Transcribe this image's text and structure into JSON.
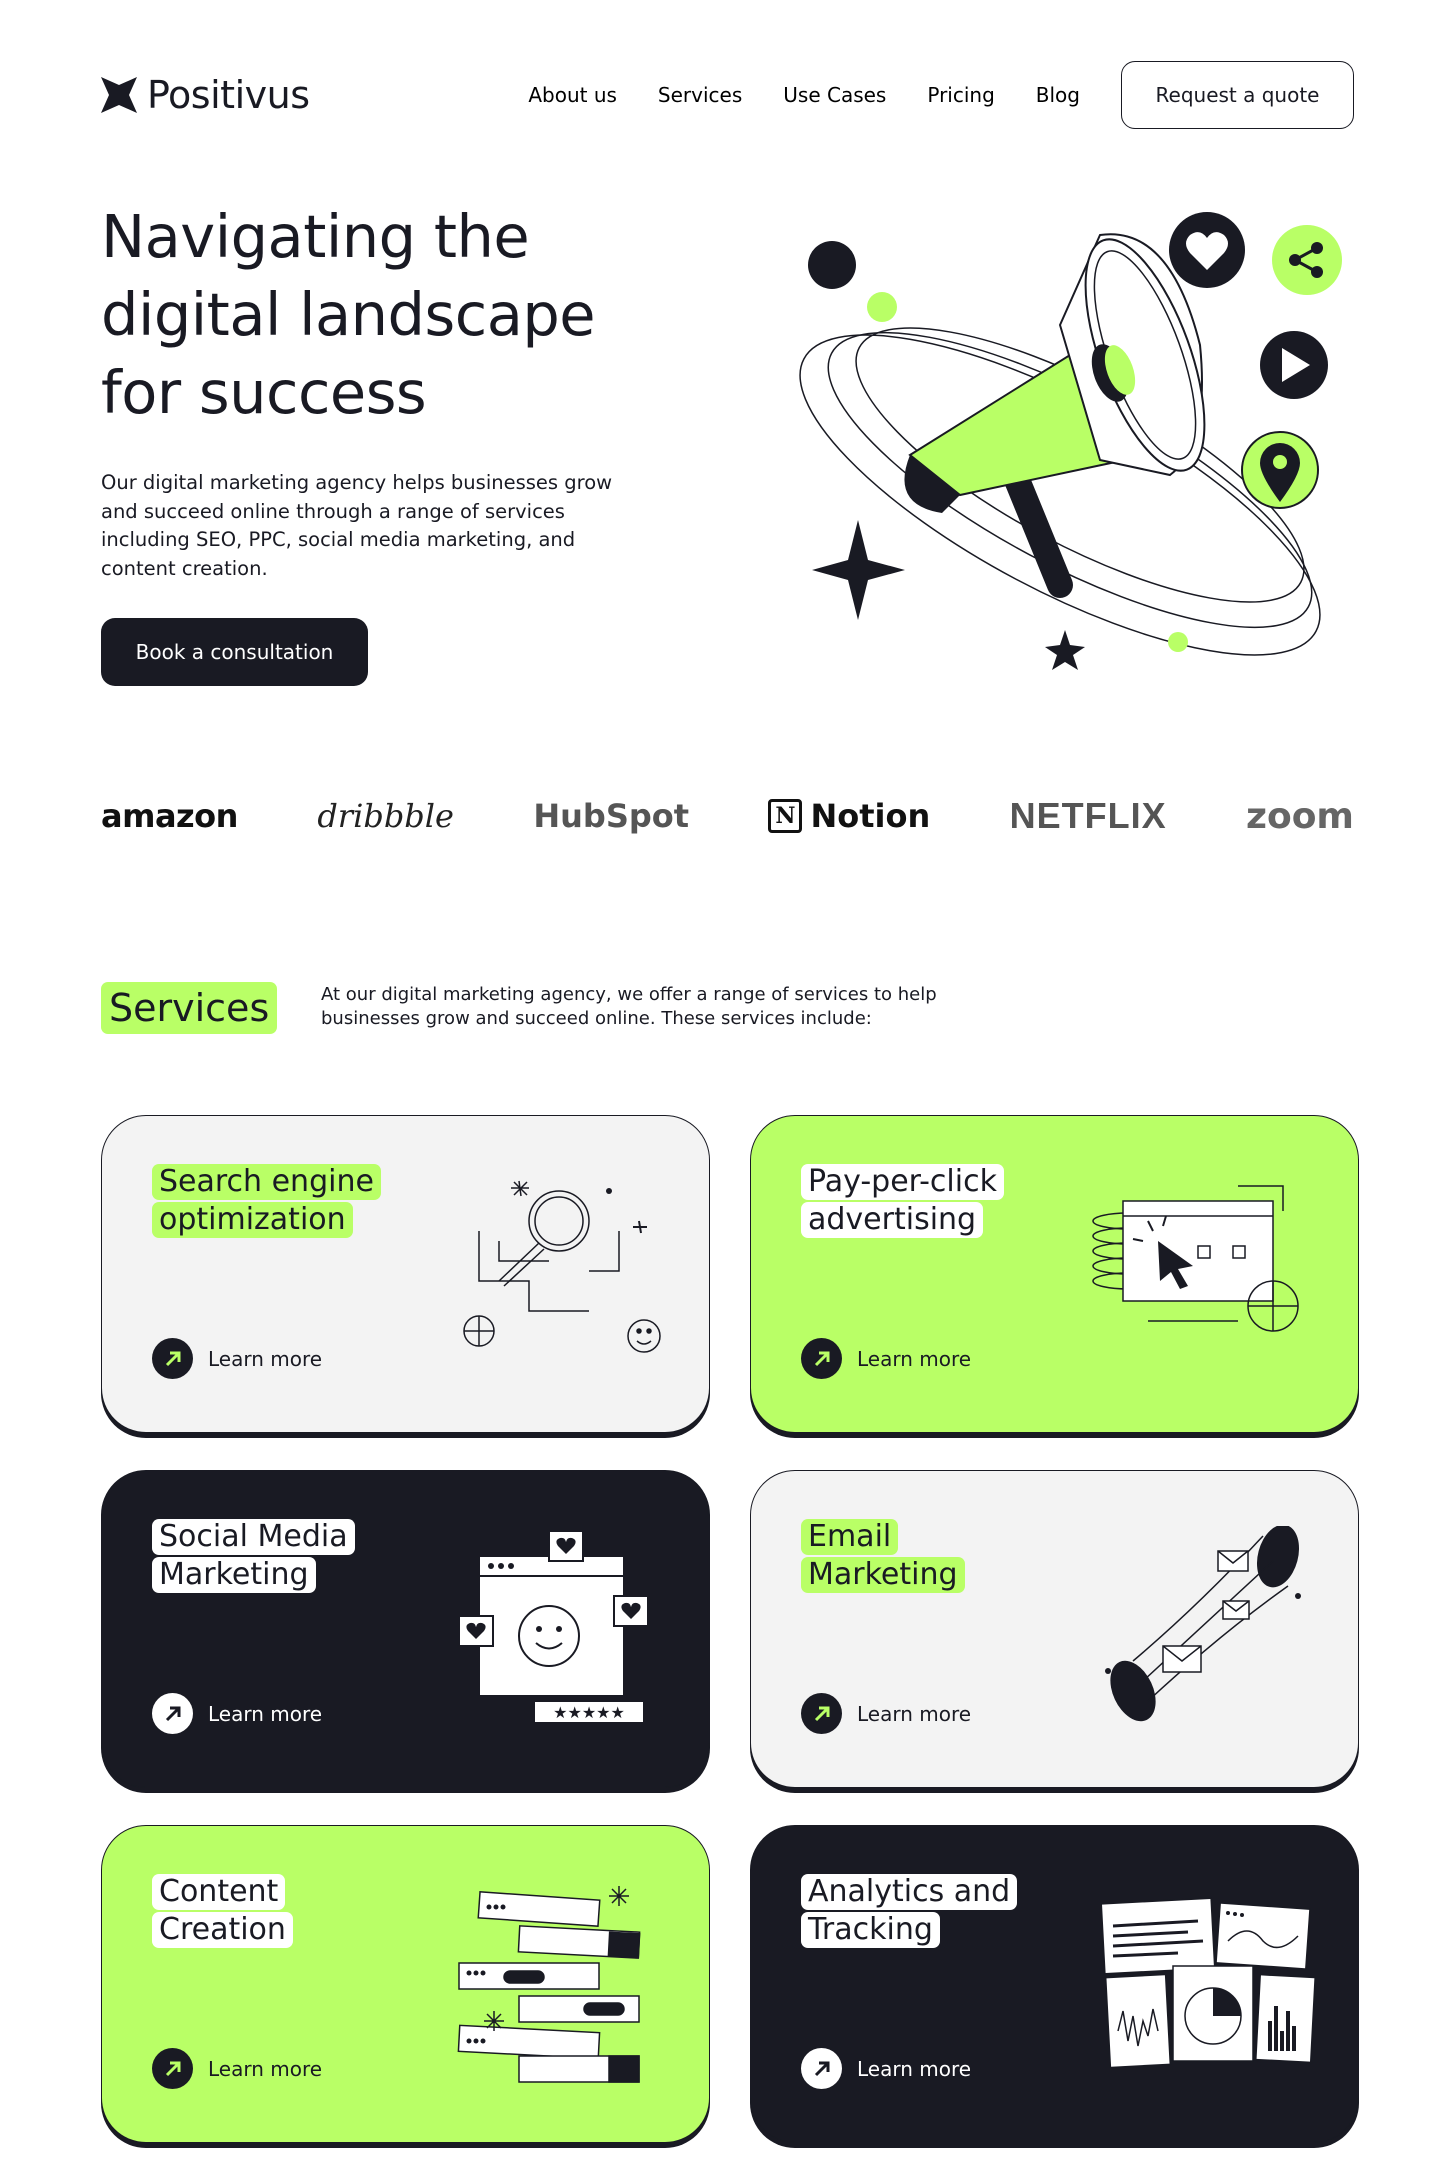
{
  "header": {
    "logo_text": "Positivus",
    "nav": [
      "About us",
      "Services",
      "Use Cases",
      "Pricing",
      "Blog"
    ],
    "cta": "Request a quote"
  },
  "hero": {
    "title": "Navigating the digital landscape for success",
    "description": "Our digital marketing agency helps businesses grow and succeed online through a range of services including SEO, PPC, social media marketing, and content creation.",
    "button": "Book a consultation"
  },
  "logos": {
    "amazon": "amazon",
    "dribbble": "dribbble",
    "hubspot": "HubSpot",
    "notion": "Notion",
    "notion_mark": "N",
    "netflix": "NETFLIX",
    "zoom": "zoom"
  },
  "services": {
    "heading": "Services",
    "intro": "At our digital marketing agency, we offer a range of services to help businesses grow and succeed online. These services include:",
    "learn_more": "Learn more",
    "cards": [
      {
        "line1": "Search engine",
        "line2": "optimization",
        "style": "grey"
      },
      {
        "line1": "Pay-per-click",
        "line2": "advertising",
        "style": "lime"
      },
      {
        "line1": "Social Media",
        "line2": "Marketing",
        "style": "dark"
      },
      {
        "line1": "Email",
        "line2": "Marketing",
        "style": "grey"
      },
      {
        "line1": "Content",
        "line2": "Creation",
        "style": "lime"
      },
      {
        "line1": "Analytics and",
        "line2": "Tracking",
        "style": "dark"
      }
    ]
  },
  "colors": {
    "accent": "#B9FF66",
    "dark": "#191A23",
    "grey": "#F3F3F3"
  }
}
